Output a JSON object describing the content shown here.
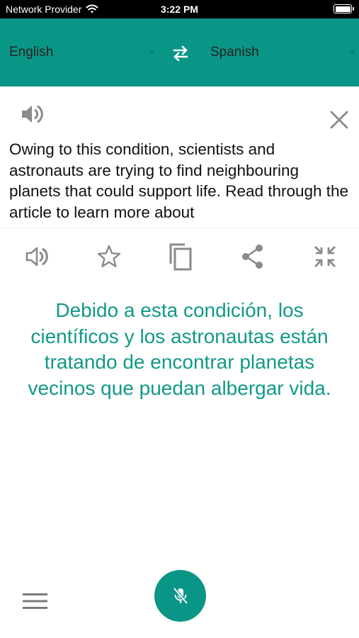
{
  "status_bar": {
    "carrier": "Network Provider",
    "time": "3:22 PM",
    "battery_level": 1.0
  },
  "languages": {
    "source": "English",
    "target": "Spanish"
  },
  "input": {
    "text": "Owing to this condition, scientists and astronauts are trying to find neighbouring planets that could support life. Read through the article to learn more about"
  },
  "output": {
    "text": "Debido a esta condición, los científicos y los astronautas están tratando de encontrar planetas vecinos que puedan albergar vida."
  },
  "colors": {
    "accent": "#0a9687",
    "translation_text": "#129987",
    "icon_gray": "#888888"
  },
  "icons": [
    "wifi-icon",
    "battery-icon",
    "swap-icon",
    "speaker-icon",
    "close-icon",
    "star-icon",
    "copy-icon",
    "share-icon",
    "collapse-icon",
    "menu-icon",
    "mic-off-icon"
  ]
}
